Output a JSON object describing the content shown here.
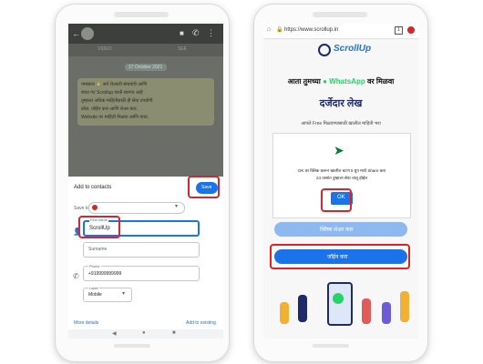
{
  "left_phone": {
    "chat": {
      "tab_left": "VIDEO",
      "tab_right": "SEE",
      "date_chip": "17 October 2021",
      "message_lines": [
        "नमस्कार 🙏 सर्व शेतकरी बांधवांचे आणि",
        "बचत गट Scrollup वरती स्वागत आहे",
        "तुम्हाला अधिक माहितीसाठी ही सेवा उपयोगी",
        "ठरेल. जॉईन करा आणि शेअर करा.",
        "Website वर माहिती मिळवा आणि वाचा."
      ]
    },
    "sheet": {
      "title": "Add to contacts",
      "save_label": "Save",
      "save_to_label": "Save to",
      "first_name_label": "First name",
      "first_name_value": "ScrollUp",
      "surname_placeholder": "Surname",
      "phone_label": "Phone",
      "phone_value": "+919999999999",
      "label_field_label": "Label",
      "label_value": "Mobile",
      "more_details": "More details",
      "add_to_existing": "Add to existing"
    }
  },
  "right_phone": {
    "browser": {
      "url": "https://www.scrollup.in",
      "tab_count": "1"
    },
    "brand": "ScrollUp",
    "headline_part1": "आता तुमच्या",
    "headline_whatsapp": "WhatsApp",
    "headline_part2": "वर मिळवा",
    "subheadline": "दर्जेदार लेख",
    "tagline": "आपले Free मिळवण्यासाठी खालील माहिती भरा",
    "dialog": {
      "line1": "OK वर क्लिक करून खालील बटण 5 ग्रुप मध्ये Share करा",
      "line2": "24 तासांत तुम्हाला सेवा चालू होईल",
      "ok_label": "OK"
    },
    "share_button_label": "क्लिक शेअर करा",
    "join_button_label": "जॉईन करा"
  },
  "colors": {
    "highlight_red": "#d6262b",
    "button_blue": "#1a73e8",
    "whatsapp_green": "#25d366"
  }
}
